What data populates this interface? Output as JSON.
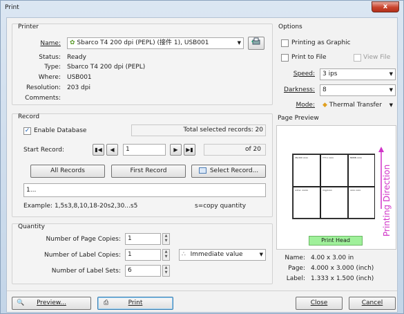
{
  "window": {
    "title": "Print",
    "close_glyph": "x"
  },
  "printer": {
    "group_label": "Printer",
    "name_label": "Name:",
    "name_value": "Sbarco T4 200 dpi (PEPL) (接件 1),  USB001",
    "status_label": "Status:",
    "status_value": "Ready",
    "type_label": "Type:",
    "type_value": "Sbarco T4 200 dpi (PEPL)",
    "where_label": "Where:",
    "where_value": "USB001",
    "resolution_label": "Resolution:",
    "resolution_value": "203 dpi",
    "comments_label": "Comments:"
  },
  "options": {
    "group_label": "Options",
    "printing_as_graphic": "Printing as Graphic",
    "print_to_file": "Print to File",
    "view_file": "View File",
    "speed_label": "Speed:",
    "speed_value": "3  ips",
    "darkness_label": "Darkness:",
    "darkness_value": "8",
    "mode_label": "Mode:",
    "mode_value": "Thermal Transfer"
  },
  "record": {
    "group_label": "Record",
    "enable_database": "Enable Database",
    "total_selected": "Total selected records: 20",
    "start_record_label": "Start Record:",
    "start_record_value": "1",
    "of_total": "of 20",
    "all_records": "All Records",
    "first_record": "First Record",
    "select_record": "Select Record...",
    "range_value": "1...",
    "example": "Example: 1,5s3,8,10,18-20s2,30...s5",
    "copy_hint": "s=copy quantity"
  },
  "quantity": {
    "group_label": "Quantity",
    "page_copies_label": "Number of Page Copies:",
    "page_copies_value": "1",
    "label_copies_label": "Number of Label Copies:",
    "label_copies_value": "1",
    "immediate_value": "Immediate value",
    "label_sets_label": "Number of Label Sets:",
    "label_sets_value": "6"
  },
  "preview": {
    "group_label": "Page Preview",
    "direction": "Printing Direction",
    "print_head": "Print Head",
    "cells": [
      "SN-000 xxxx",
      "YYY-x xxxx",
      "NNNN xxxx",
      "Lotno: xxxxx",
      "img/xxxx",
      "xxxx xxxx"
    ],
    "name_label": "Name:",
    "name_value": "4.00 x 3.00 in",
    "page_label": "Page:",
    "page_value": "4.000 x 3.000 (inch)",
    "label_label": "Label:",
    "label_value": "1.333 x 1.500 (inch)"
  },
  "footer": {
    "preview": "Preview...",
    "print": "Print",
    "close": "Close",
    "cancel": "Cancel"
  },
  "colors": {
    "accent": "#d033c8",
    "print_head": "#9ff09a"
  }
}
